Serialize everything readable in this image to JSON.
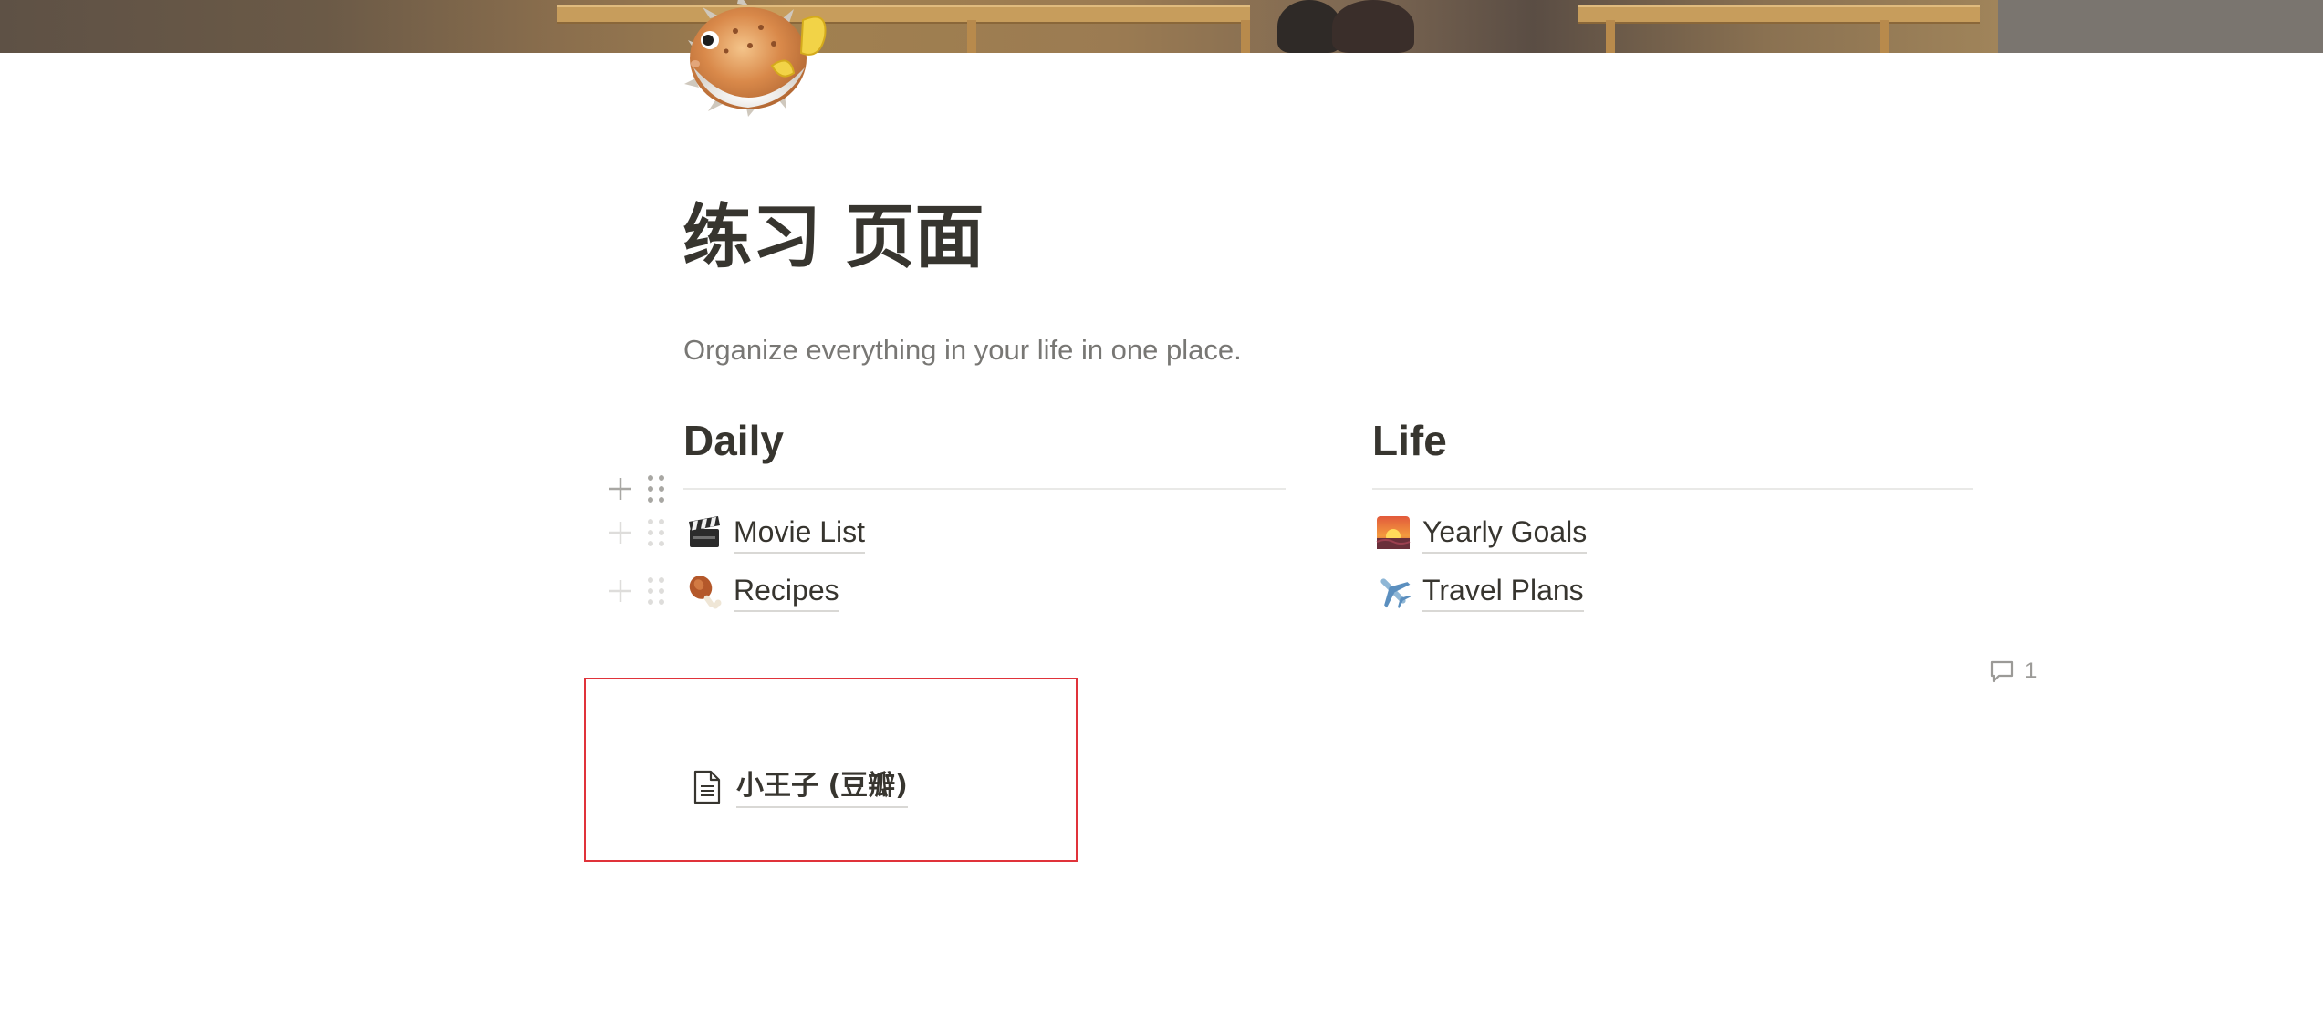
{
  "page": {
    "title": "练习 页面",
    "subtitle": "Organize everything in your life in one place.",
    "icon": "blowfish-icon"
  },
  "columns": [
    {
      "heading": "Daily",
      "links": [
        {
          "icon": "clapper-board-icon",
          "label": "Movie List"
        },
        {
          "icon": "poultry-leg-icon",
          "label": "Recipes"
        }
      ]
    },
    {
      "heading": "Life",
      "links": [
        {
          "icon": "sunrise-icon",
          "label": "Yearly Goals"
        },
        {
          "icon": "airplane-icon",
          "label": "Travel Plans"
        }
      ]
    }
  ],
  "comments": {
    "count": "1",
    "icon": "comment-icon"
  },
  "subpage": {
    "icon": "page-document-icon",
    "label": "小王子 (豆瓣)"
  },
  "colors": {
    "text": "#37352f",
    "muted": "#787774",
    "highlight_border": "#e0333a",
    "divider": "#e9e9e7"
  }
}
